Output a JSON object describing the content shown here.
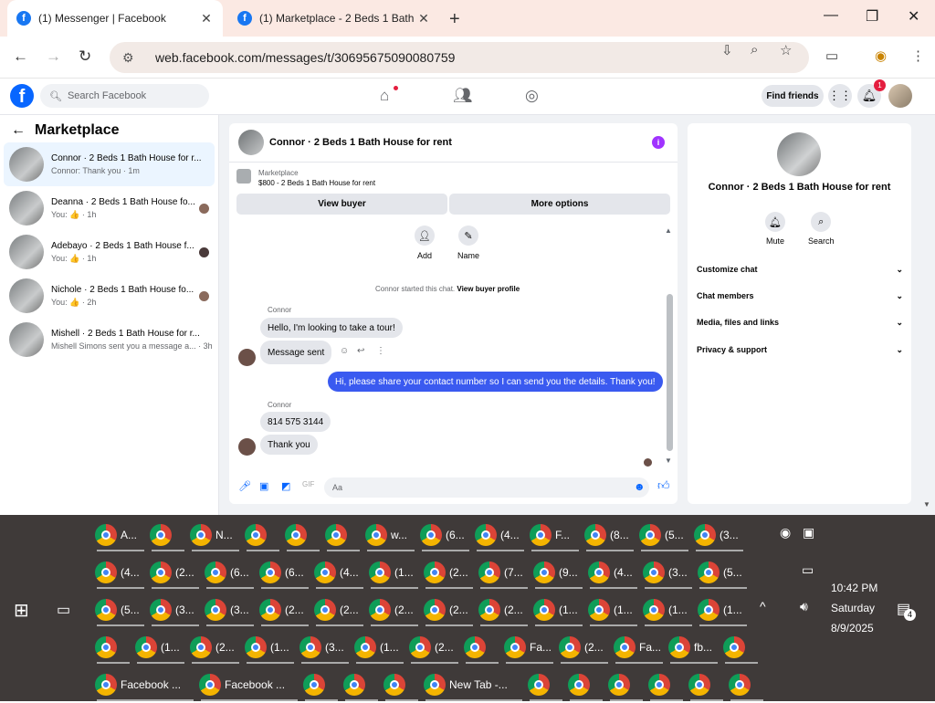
{
  "browser": {
    "tabs": [
      {
        "title": "(1) Messenger | Facebook",
        "active": true
      },
      {
        "title": "(1) Marketplace - 2 Beds 1 Bath",
        "active": false
      }
    ],
    "url": "web.facebook.com/messages/t/30695675090080759"
  },
  "fb_header": {
    "search_placeholder": "Search Facebook",
    "find_friends": "Find friends",
    "notifications_count": "1"
  },
  "left": {
    "title": "Marketplace",
    "conversations": [
      {
        "name": "Connor · 2 Beds 1 Bath House for r...",
        "snippet": "Connor: Thank you · 1m"
      },
      {
        "name": "Deanna · 2 Beds 1 Bath House fo...",
        "snippet": "You: 👍 · 1h"
      },
      {
        "name": "Adebayo · 2 Beds 1 Bath House f...",
        "snippet": "You: 👍 · 1h"
      },
      {
        "name": "Nichole · 2 Beds 1 Bath House fo...",
        "snippet": "You: 👍 · 2h"
      },
      {
        "name": "Mishell · 2 Beds 1 Bath House for r...",
        "snippet": "Mishell Simons sent you a message a... · 3h"
      }
    ]
  },
  "chat": {
    "title": "Connor · 2 Beds 1 Bath House for rent",
    "marketplace_label": "Marketplace",
    "listing": "$800 - 2 Beds 1 Bath House for rent",
    "view_buyer": "View buyer",
    "more_options": "More options",
    "add_label": "Add",
    "name_label": "Name",
    "system_msg": "Connor started this chat.",
    "system_link": "View buyer profile",
    "sender1": "Connor",
    "msg1": "Hello, I'm looking to take a tour!",
    "msg2": "Message sent",
    "msg3": "Hi, please share your contact number so I can send you the details. Thank you!",
    "sender2": "Connor",
    "msg4": "814 575 3144",
    "msg5": "Thank you",
    "composer_placeholder": "Aa"
  },
  "right": {
    "name": "Connor · 2 Beds 1 Bath House for rent",
    "mute": "Mute",
    "search": "Search",
    "sections": [
      "Customize chat",
      "Chat members",
      "Media, files and links",
      "Privacy & support"
    ]
  },
  "taskbar": {
    "row1": [
      "A...",
      "",
      "N...",
      "",
      "",
      "",
      "w...",
      "(6...",
      "(4...",
      "F...",
      "(8...",
      "(5...",
      "(3..."
    ],
    "row2": [
      "(4...",
      "(2...",
      "(6...",
      "(6...",
      "(4...",
      "(1...",
      "(2...",
      "(7...",
      "(9...",
      "(4...",
      "(3...",
      "(5..."
    ],
    "row3": [
      "(5...",
      "(3...",
      "(3...",
      "(2...",
      "(2...",
      "(2...",
      "(2...",
      "(2...",
      "(1...",
      "(1...",
      "(1...",
      "(1..."
    ],
    "row4": [
      "",
      "(1...",
      "(2...",
      "(1...",
      "(3...",
      "(1...",
      "(2...",
      "",
      "Fa...",
      "(2...",
      "Fa...",
      "fb...",
      ""
    ],
    "row5": [
      "Facebook ...",
      "Facebook ...",
      "",
      "",
      "",
      "New Tab -...",
      "",
      "",
      "",
      "",
      "",
      ""
    ],
    "time": "10:42 PM",
    "day": "Saturday",
    "date": "8/9/2025",
    "notif_count": "4"
  }
}
